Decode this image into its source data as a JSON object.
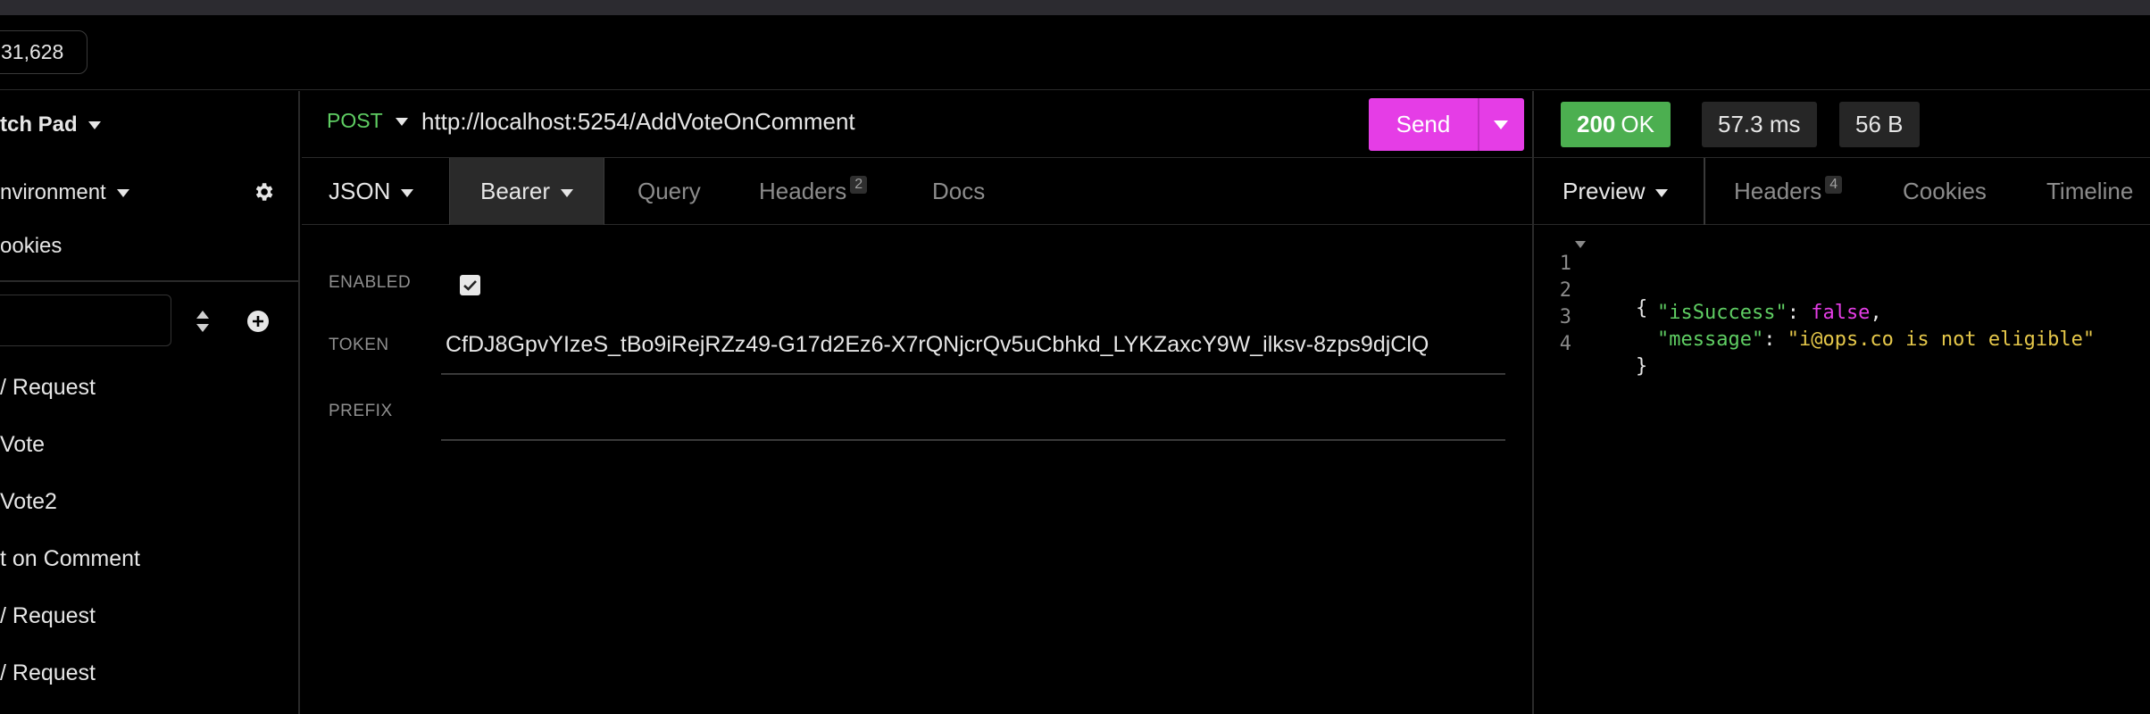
{
  "topbar": {
    "count": "31,628"
  },
  "sidebar": {
    "workspace": "tch Pad",
    "environment": "nvironment",
    "cookies": "ookies",
    "items": [
      {
        "label": "/ Request"
      },
      {
        "label": " Vote"
      },
      {
        "label": " Vote2"
      },
      {
        "label": "t on Comment"
      },
      {
        "label": "/ Request"
      },
      {
        "label": "/ Request"
      }
    ]
  },
  "request": {
    "method": "POST",
    "url": "http://localhost:5254/AddVoteOnComment",
    "send_label": "Send",
    "tabs": {
      "body": "JSON",
      "auth": "Bearer",
      "query": "Query",
      "headers": "Headers",
      "headers_count": "2",
      "docs": "Docs"
    },
    "auth": {
      "enabled_label": "ENABLED",
      "enabled": true,
      "token_label": "TOKEN",
      "token_value": "CfDJ8GpvYIzeS_tBo9iRejRZz49-G17d2Ez6-X7rQNjcrQv5uCbhkd_LYKZaxcY9W_ilksv-8zps9djClQ",
      "prefix_label": "PREFIX",
      "prefix_value": ""
    }
  },
  "response": {
    "status_code": "200",
    "status_text": "OK",
    "time": "57.3 ms",
    "size": "56 B",
    "tabs": {
      "preview": "Preview",
      "headers": "Headers",
      "headers_count": "4",
      "cookies": "Cookies",
      "timeline": "Timeline"
    },
    "lines": [
      {
        "n": "1",
        "open": "{"
      },
      {
        "n": "2",
        "key": "\"isSuccess\"",
        "sep": ": ",
        "bool": "false",
        "end": ","
      },
      {
        "n": "3",
        "key": "\"message\"",
        "sep": ": ",
        "str": "\"i@ops.co is not eligible\""
      },
      {
        "n": "4",
        "close": "}"
      }
    ]
  },
  "colors": {
    "accent": "#e53de6",
    "success": "#4caf50",
    "method_post": "#5fce63",
    "json_key": "#5fce63",
    "json_bool": "#e53de6",
    "json_string": "#e6c84a"
  },
  "icons": [
    "gear-icon",
    "sort-icon",
    "add-icon",
    "checkmark-icon",
    "chevron-down-icon"
  ]
}
